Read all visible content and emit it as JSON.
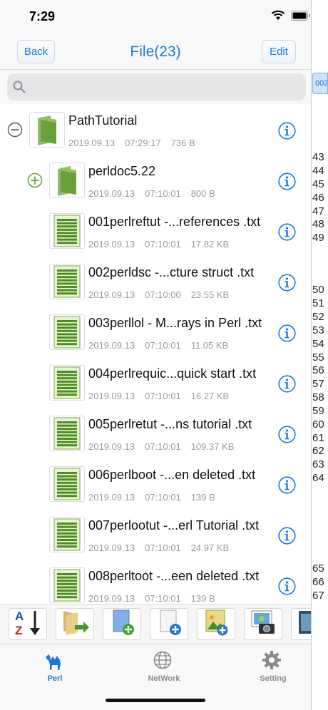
{
  "status": {
    "time": "7:29"
  },
  "nav": {
    "back_label": "Back",
    "title": "File(23)",
    "edit_label": "Edit"
  },
  "search": {
    "placeholder": ""
  },
  "files": [
    {
      "name": "PathTutorial",
      "date": "2019.09.13",
      "time": "07:29:17",
      "size": "736 B",
      "kind": "folder",
      "toggle": "collapse"
    },
    {
      "name": "perldoc5.22",
      "date": "2019.09.13",
      "time": "07:10:01",
      "size": "800 B",
      "kind": "folder",
      "toggle": "expand"
    },
    {
      "name": "001perlreftut -...references .txt",
      "date": "2019.09.13",
      "time": "07:10:01",
      "size": "17.82 KB",
      "kind": "text"
    },
    {
      "name": "002perldsc -...cture struct .txt",
      "date": "2019.09.13",
      "time": "07:10:00",
      "size": "23.55 KB",
      "kind": "text"
    },
    {
      "name": "003perllol - M...rays in Perl .txt",
      "date": "2019.09.13",
      "time": "07:10:01",
      "size": "11.05 KB",
      "kind": "text"
    },
    {
      "name": "004perlrequic...quick start .txt",
      "date": "2019.09.13",
      "time": "07:10:01",
      "size": "16.27 KB",
      "kind": "text"
    },
    {
      "name": "005perlretut -...ns tutorial .txt",
      "date": "2019.09.13",
      "time": "07:10:01",
      "size": "109.37 KB",
      "kind": "text"
    },
    {
      "name": "006perlboot -...en deleted .txt",
      "date": "2019.09.13",
      "time": "07:10:01",
      "size": "139 B",
      "kind": "text"
    },
    {
      "name": "007perlootut -...erl Tutorial .txt",
      "date": "2019.09.13",
      "time": "07:10:01",
      "size": "24.97 KB",
      "kind": "text"
    },
    {
      "name": "008perltoot -...een deleted .txt",
      "date": "2019.09.13",
      "time": "07:10:01",
      "size": "139 B",
      "kind": "text"
    }
  ],
  "toolbar": {
    "buttons": [
      "sort-az-icon",
      "move-folder-icon",
      "new-file-icon",
      "add-blank-file-icon",
      "add-image-file-icon",
      "camera-photo-icon",
      "gallery-icon"
    ]
  },
  "tabs": [
    {
      "label": "Perl",
      "icon": "camel-icon",
      "active": true
    },
    {
      "label": "NetWork",
      "icon": "globe-icon",
      "active": false
    },
    {
      "label": "Setting",
      "icon": "gear-icon",
      "active": false
    }
  ],
  "background": {
    "tab_label": "002",
    "line_numbers": [
      "43",
      "44",
      "45",
      "46",
      "47",
      "48",
      "49",
      "50",
      "51",
      "52",
      "53",
      "54",
      "55",
      "56",
      "57",
      "58",
      "59",
      "60",
      "61",
      "62",
      "63",
      "64",
      "65",
      "66",
      "67"
    ]
  },
  "colors": {
    "accent": "#1a7ad9",
    "folder": "#6aa23a",
    "toggle_green": "#6aa23a"
  }
}
